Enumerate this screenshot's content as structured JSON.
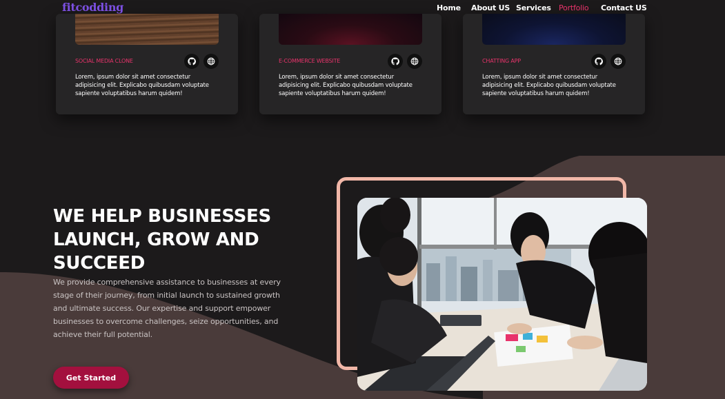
{
  "brand": {
    "logo_text": "fitcodding"
  },
  "nav": {
    "links": [
      {
        "label": "Home",
        "active": false
      },
      {
        "label": "About US",
        "active": false
      },
      {
        "label": "Services",
        "active": false
      },
      {
        "label": "Portfolio",
        "active": true
      },
      {
        "label": "Contact US",
        "active": false
      }
    ]
  },
  "portfolio": {
    "cards": [
      {
        "title": "SOCIAL MEDIA CLONE",
        "description": "Lorem, ipsum dolor sit amet consectetur adipisicing elit. Explicabo quibusdam voluptate sapiente voluptatibus harum quidem!",
        "icons": [
          "github-icon",
          "globe-icon"
        ]
      },
      {
        "title": "E-COMMERCE WEBSITE",
        "description": "Lorem, ipsum dolor sit amet consectetur adipisicing elit. Explicabo quibusdam voluptate sapiente voluptatibus harum quidem!",
        "icons": [
          "github-icon",
          "globe-icon"
        ]
      },
      {
        "title": "CHATTING APP",
        "description": "Lorem, ipsum dolor sit amet consectetur adipisicing elit. Explicabo quibusdam voluptate sapiente voluptatibus harum quidem!",
        "icons": [
          "github-icon",
          "globe-icon"
        ]
      }
    ]
  },
  "hero": {
    "title": "WE HELP BUSINESSES LAUNCH, GROW AND SUCCEED",
    "description": "We provide comprehensive assistance to businesses at every stage of their journey, from initial launch to sustained growth and ultimate success. Our expertise and support empower businesses to overcome challenges, seize opportunities, and achieve their full potential.",
    "cta_label": "Get Started"
  },
  "colors": {
    "background": "#1c1a1b",
    "accent": "#e8336b",
    "button": "#a3103e",
    "frame": "#f1b7a8",
    "wave": "#4a3b3a"
  }
}
